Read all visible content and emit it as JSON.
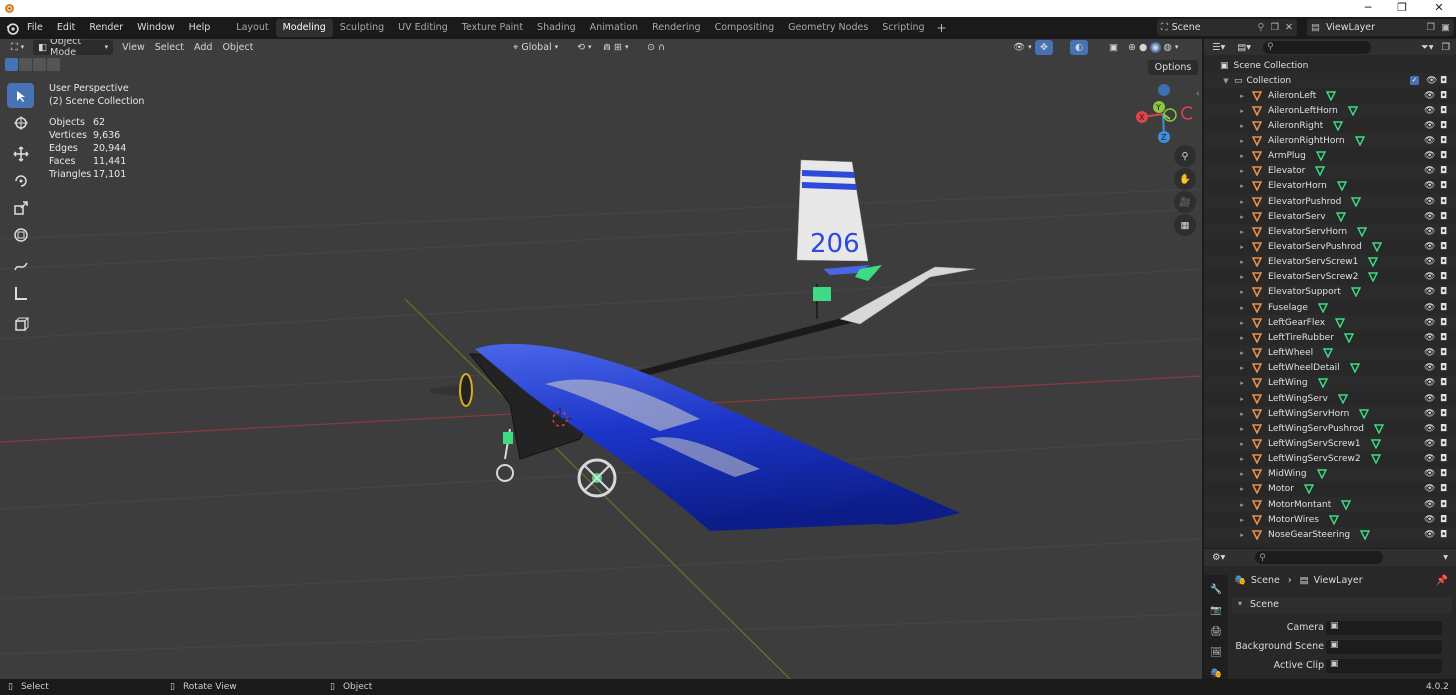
{
  "titlebar": {
    "minimize": "─",
    "restore": "❐",
    "close": "✕"
  },
  "menu": [
    "File",
    "Edit",
    "Render",
    "Window",
    "Help"
  ],
  "workspaces": [
    "Layout",
    "Modeling",
    "Sculpting",
    "UV Editing",
    "Texture Paint",
    "Shading",
    "Animation",
    "Rendering",
    "Compositing",
    "Geometry Nodes",
    "Scripting"
  ],
  "active_workspace": "Modeling",
  "scene_name": "Scene",
  "view_layer": "ViewLayer",
  "viewport_header": {
    "mode": "Object Mode",
    "menus": [
      "View",
      "Select",
      "Add",
      "Object"
    ],
    "orientation": "Global",
    "options": "Options"
  },
  "overlay": {
    "perspective": "User Perspective",
    "collection": "(2) Scene Collection",
    "stats": [
      {
        "label": "Objects",
        "value": "62"
      },
      {
        "label": "Vertices",
        "value": "9,636"
      },
      {
        "label": "Edges",
        "value": "20,944"
      },
      {
        "label": "Faces",
        "value": "11,441"
      },
      {
        "label": "Triangles",
        "value": "17,101"
      }
    ]
  },
  "model_text": {
    "tail_number": "206"
  },
  "gizmo": {
    "x": "X",
    "y": "Y",
    "z": "Z"
  },
  "outliner": {
    "root": "Scene Collection",
    "collection": "Collection",
    "items": [
      "AileronLeft",
      "AileronLeftHorn",
      "AileronRight",
      "AileronRightHorn",
      "ArmPlug",
      "Elevator",
      "ElevatorHorn",
      "ElevatorPushrod",
      "ElevatorServ",
      "ElevatorServHorn",
      "ElevatorServPushrod",
      "ElevatorServScrew1",
      "ElevatorServScrew2",
      "ElevatorSupport",
      "Fuselage",
      "LeftGearFlex",
      "LeftTireRubber",
      "LeftWheel",
      "LeftWheelDetail",
      "LeftWing",
      "LeftWingServ",
      "LeftWingServHorn",
      "LeftWingServPushrod",
      "LeftWingServScrew1",
      "LeftWingServScrew2",
      "MidWing",
      "Motor",
      "MotorMontant",
      "MotorWires",
      "NoseGearSteering"
    ]
  },
  "properties": {
    "breadcrumb_scene": "Scene",
    "breadcrumb_layer": "ViewLayer",
    "panel": "Scene",
    "fields": [
      {
        "label": "Camera"
      },
      {
        "label": "Background Scene"
      },
      {
        "label": "Active Clip"
      }
    ]
  },
  "statusbar": {
    "select": "Select",
    "rotate": "Rotate View",
    "object": "Object",
    "version": "4.0.2"
  },
  "colors": {
    "accent": "#4772b3",
    "wing_blue": "#1f3fd8",
    "mesh_green": "#3ddc84",
    "x_axis": "#e0434b",
    "y_axis": "#8cc63f",
    "z_axis": "#3d8fdb"
  }
}
